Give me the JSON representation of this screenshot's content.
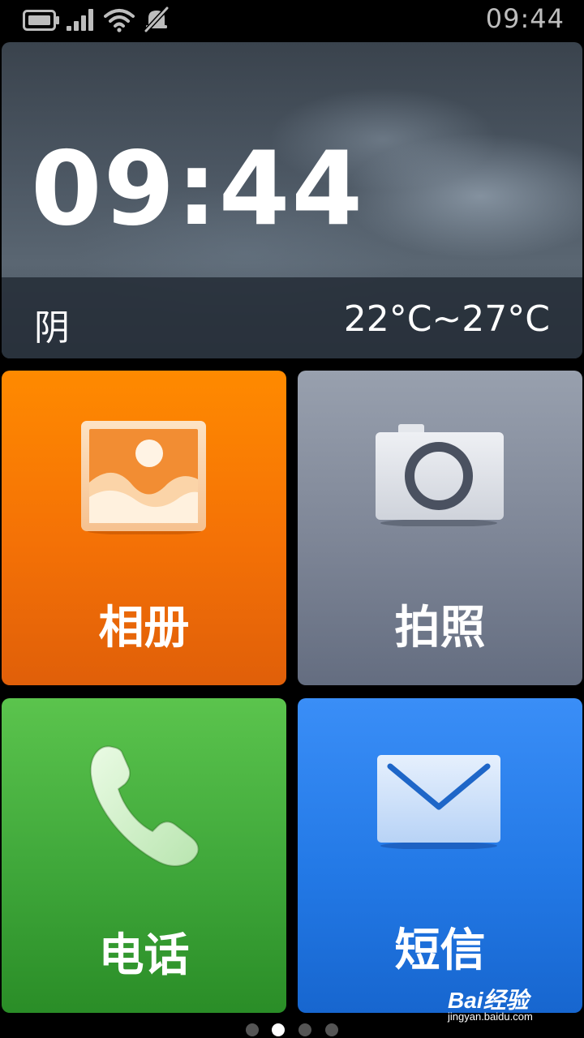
{
  "status_bar": {
    "time": "09:44",
    "icons": [
      "battery-icon",
      "signal-icon",
      "wifi-icon",
      "mute-icon"
    ]
  },
  "weather": {
    "time": "09:44",
    "condition": "阴",
    "temperature_range": "22°C~27°C"
  },
  "tiles": [
    {
      "label": "相册",
      "icon": "gallery-icon",
      "color": "#f47106"
    },
    {
      "label": "拍照",
      "icon": "camera-icon",
      "color": "#7d8596"
    },
    {
      "label": "电话",
      "icon": "phone-icon",
      "color": "#3fa73a"
    },
    {
      "label": "短信",
      "icon": "message-icon",
      "color": "#2379e6"
    }
  ],
  "pager": {
    "page_count": 4,
    "current_page": 2
  },
  "watermark": {
    "logo": "Bai经验",
    "url": "jingyan.baidu.com"
  }
}
